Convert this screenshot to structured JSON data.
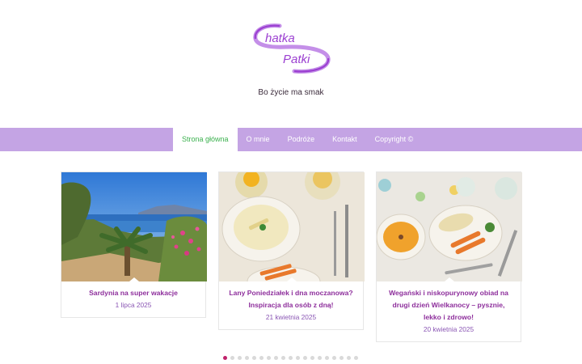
{
  "header": {
    "logo_text_line1": "hatka",
    "logo_text_line2": "Patki",
    "tagline": "Bo życie ma smak"
  },
  "nav": {
    "items": [
      {
        "label": "Strona główna",
        "active": true
      },
      {
        "label": "O mnie",
        "active": false
      },
      {
        "label": "Podróże",
        "active": false
      },
      {
        "label": "Kontakt",
        "active": false
      },
      {
        "label": "Copyright ©",
        "active": false
      }
    ]
  },
  "posts": [
    {
      "title": "Sardynia na super wakacje",
      "date": "1 lipca 2025"
    },
    {
      "title": "Lany Poniedziałek i dna moczanowa? Inspiracja dla osób z dną!",
      "date": "21 kwietnia 2025"
    },
    {
      "title": "Wegański i niskopurynowy obiad na drugi dzień Wielkanocy – pysznie, lekko i zdrowo!",
      "date": "20 kwietnia 2025"
    }
  ],
  "carousel": {
    "dot_count": 19,
    "active_index": 0
  },
  "colors": {
    "nav_bg": "#c4a4e4",
    "nav_active_text": "#3bb14e",
    "post_title": "#8e2f9c",
    "post_date": "#8a56b4",
    "dot_active": "#c0226b",
    "logo": "#9b3fd1"
  }
}
